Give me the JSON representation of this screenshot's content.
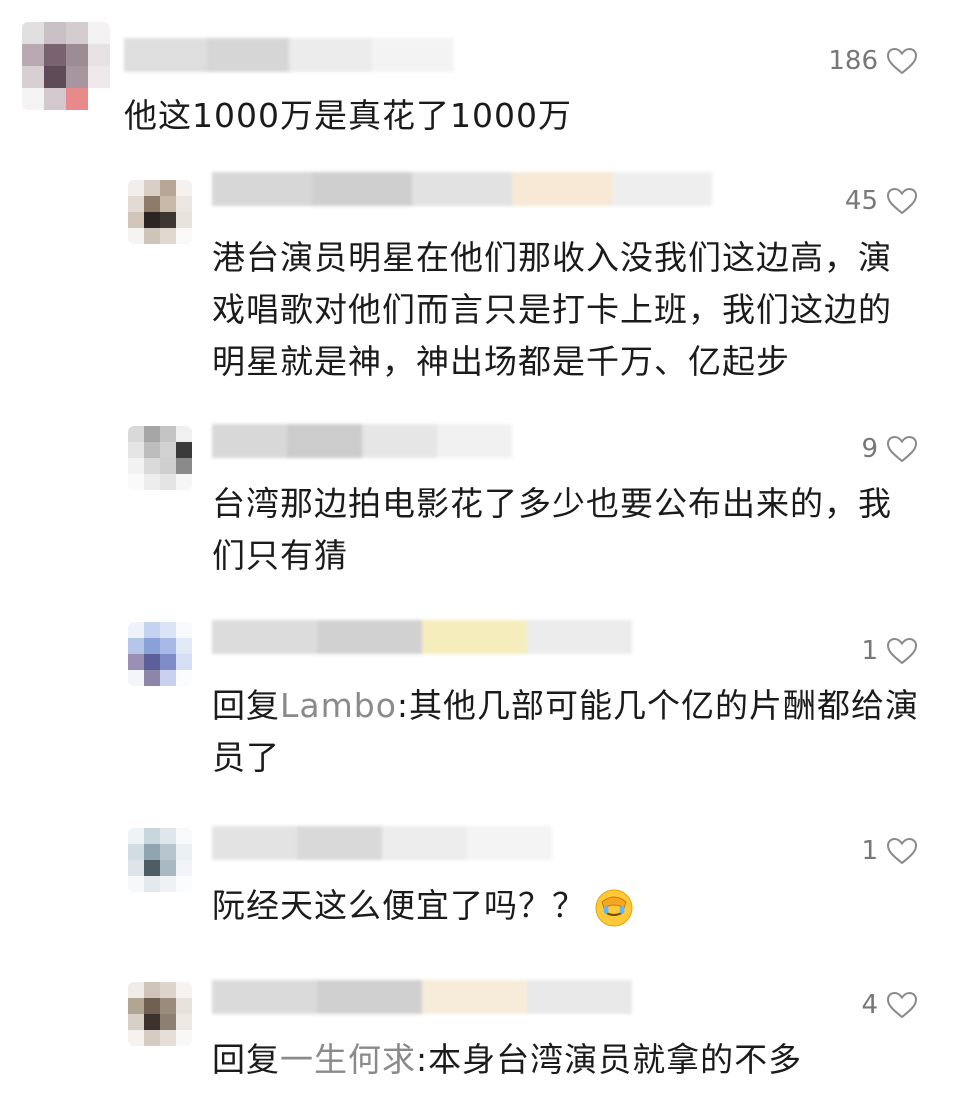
{
  "comments": [
    {
      "likes": "186",
      "text": "他这1000万是真花了1000万",
      "avatar_colors": [
        "#e2dfe0",
        "#c9c0c5",
        "#d4cccf",
        "#f4f2f2",
        "#b9a9b2",
        "#7a6270",
        "#9d8c96",
        "#e7e3e5",
        "#d8cfd3",
        "#5f4a58",
        "#a7969f",
        "#efe9eb",
        "#f5f3f4",
        "#d3c8ce",
        "#e88a8a",
        "#ffffff"
      ],
      "name_colors": [
        "#dedede",
        "#d6d6d6",
        "#ececec",
        "#f3f3f3"
      ]
    },
    {
      "likes": "45",
      "text": "港台演员明星在他们那收入没我们这边高，演戏唱歌对他们而言只是打卡上班，我们这边的明星就是神，神出场都是千万、亿起步",
      "avatar_colors": [
        "#f1eeeb",
        "#d9cfc6",
        "#b8a797",
        "#f4f1ee",
        "#e3dbd3",
        "#8f7b6a",
        "#c9b9a9",
        "#ebe6e1",
        "#d2c6ba",
        "#2a2522",
        "#3e3631",
        "#e9e3dd",
        "#f6f4f2",
        "#cfc4b9",
        "#e1d8cf",
        "#faf9f8"
      ],
      "name_colors": [
        "#d7d7d7",
        "#cfcfcf",
        "#e2e2e2",
        "#f7e9d6",
        "#eeeeee"
      ]
    },
    {
      "likes": "9",
      "text": "台湾那边拍电影花了多少也要公布出来的，我们只有猜",
      "avatar_colors": [
        "#d9d9d9",
        "#a6a6a6",
        "#c4c4c4",
        "#f0f0f0",
        "#e5e5e5",
        "#bdbdbd",
        "#d2d2d2",
        "#3a3a3a",
        "#f2f2f2",
        "#dadada",
        "#cfcfcf",
        "#8a8a8a",
        "#fafafa",
        "#ededed",
        "#e4e4e4",
        "#f6f6f6"
      ],
      "name_colors": [
        "#d8d8d8",
        "#cccccc",
        "#e6e6e6",
        "#f1f1f1"
      ]
    },
    {
      "likes": "1",
      "text": "回复",
      "mention": "Lambo",
      "text_after": ":其他几部可能几个亿的片酬都给演员了",
      "avatar_colors": [
        "#eef2fb",
        "#c5d3f0",
        "#dbe4f5",
        "#f7f9fd",
        "#b6c6ea",
        "#8aa0d8",
        "#a7b9e4",
        "#e3eaf7",
        "#9a8fb5",
        "#5c5f98",
        "#7f8cc8",
        "#d6def3",
        "#f3f5fb",
        "#8d86a8",
        "#c8d2ee",
        "#fbfcfe"
      ],
      "name_colors": [
        "#dcdcdc",
        "#d1d1d1",
        "#f6edbd",
        "#ececec"
      ]
    },
    {
      "likes": "1",
      "text": "阮经天这么便宜了吗？？",
      "avatar_colors": [
        "#eef3f6",
        "#c9d6de",
        "#dfe7ec",
        "#f7f9fa",
        "#d2dde3",
        "#8fa3b0",
        "#b6c5ce",
        "#eaf0f3",
        "#dde5ea",
        "#4e5c66",
        "#a9b8c1",
        "#f1f5f7",
        "#f6f8f9",
        "#e3e9ed",
        "#eef2f4",
        "#fbfcfd"
      ],
      "name_colors": [
        "#e3e3e3",
        "#d9d9d9",
        "#ededed",
        "#f4f4f4"
      ]
    },
    {
      "likes": "4",
      "text": "回复",
      "mention": "一生何求",
      "text_after": ":本身台湾演员就拿的不多",
      "avatar_colors": [
        "#f0ede9",
        "#cfc5bb",
        "#ddd5cc",
        "#f6f3f0",
        "#b3a594",
        "#6f6051",
        "#9a8b7b",
        "#e8e2dc",
        "#d8cfc5",
        "#3c332c",
        "#8d7f71",
        "#eee9e4",
        "#f5f2ef",
        "#d6ccc2",
        "#e6dfd8",
        "#faf8f6"
      ],
      "name_colors": [
        "#dadada",
        "#d0d0d0",
        "#f7ecd9",
        "#e9e9e9"
      ]
    }
  ],
  "icons": {
    "like": "heart-outline-icon",
    "emoji": "facepalm-crying-emoji"
  },
  "colors": {
    "text": "#1b1b1b",
    "likes": "#777777",
    "mention": "#8a8a8a",
    "background": "#ffffff"
  }
}
